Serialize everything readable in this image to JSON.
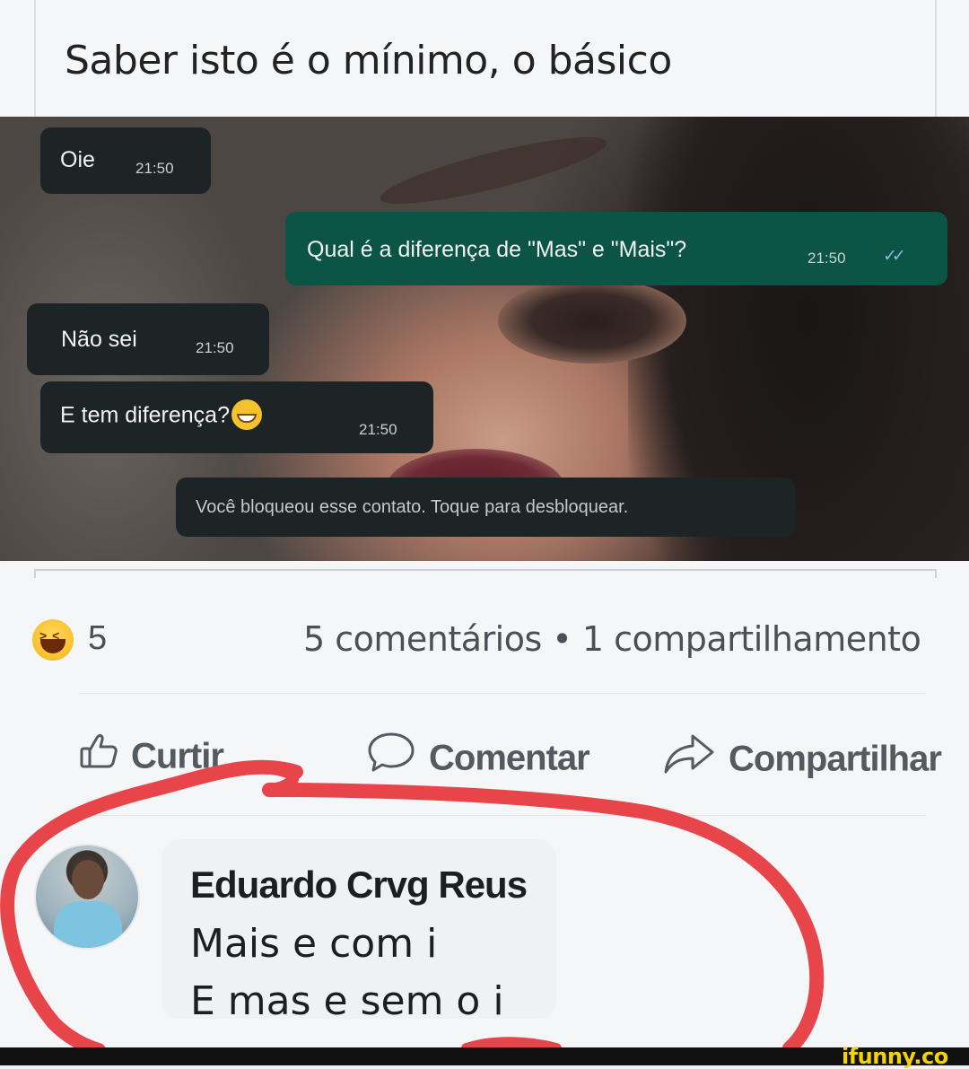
{
  "post": {
    "text": "Saber isto é o mínimo, o básico"
  },
  "chat": {
    "messages": [
      {
        "text": "Oie",
        "time": "21:50",
        "direction": "incoming"
      },
      {
        "text": "Qual é a diferença de \"Mas\" e \"Mais\"?",
        "time": "21:50",
        "direction": "outgoing",
        "status": "read"
      },
      {
        "text": "Não sei",
        "time": "21:50",
        "direction": "incoming"
      },
      {
        "text": "E tem diferença?",
        "time": "21:50",
        "direction": "incoming",
        "emoji": "grinning-sweat-emoji"
      }
    ],
    "system_notice": "Você bloqueou esse contato. Toque para desbloquear.",
    "colors": {
      "incoming": "#1c2426",
      "outgoing": "#0b5446"
    }
  },
  "reactions": {
    "icon": "haha-reaction-icon",
    "count": "5",
    "counts_text": "5 comentários • 1 compartilhamento"
  },
  "actions": {
    "like": {
      "label": "Curtir",
      "icon": "thumbs-up-icon"
    },
    "comment": {
      "label": "Comentar",
      "icon": "speech-bubble-icon"
    },
    "share": {
      "label": "Compartilhar",
      "icon": "share-arrow-icon"
    }
  },
  "comment": {
    "author": "Eduardo Crvg Reus",
    "line1": "Mais e com i",
    "line2": "E mas e sem o i"
  },
  "watermark": "ifunny.co",
  "colors": {
    "annotation_red": "#e8454b",
    "watermark": "#f4d20b"
  }
}
